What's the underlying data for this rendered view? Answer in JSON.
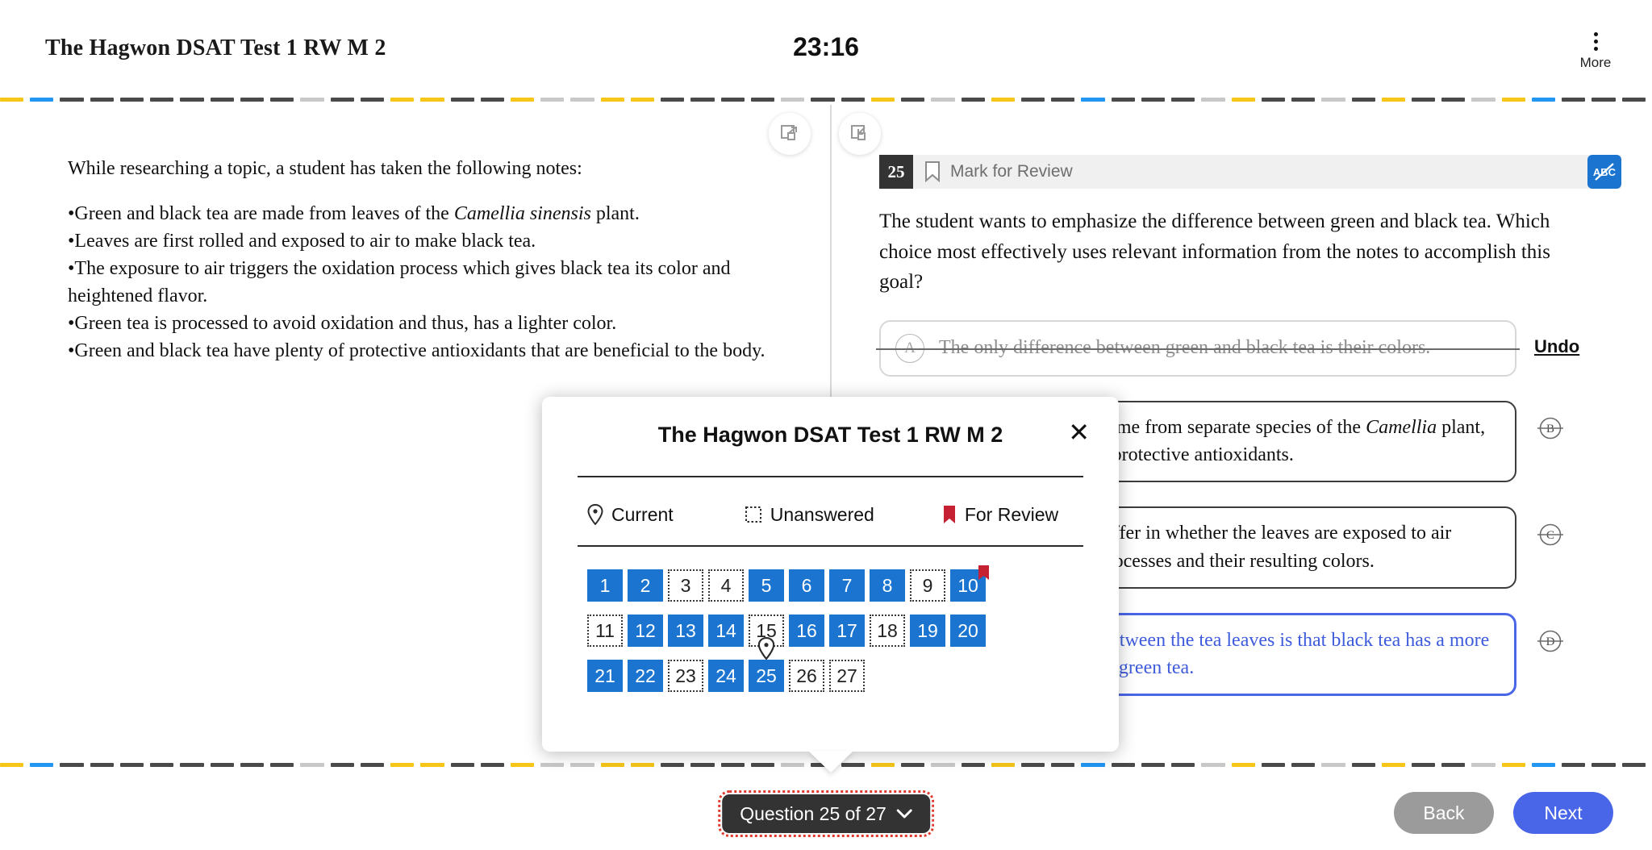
{
  "header": {
    "test_title": "The Hagwon DSAT Test 1 RW M 2",
    "timer": "23:16",
    "more_label": "More"
  },
  "divider": {
    "colors": [
      "#f5c518",
      "#2196f3",
      "#4a4a4a",
      "#4a4a4a",
      "#4a4a4a",
      "#4a4a4a",
      "#4a4a4a",
      "#4a4a4a",
      "#4a4a4a",
      "#4a4a4a",
      "#c8c8c8",
      "#4a4a4a",
      "#4a4a4a",
      "#f5c518",
      "#f5c518",
      "#4a4a4a",
      "#4a4a4a",
      "#f5c518",
      "#c8c8c8",
      "#c8c8c8",
      "#f5c518",
      "#f5c518",
      "#4a4a4a",
      "#4a4a4a",
      "#4a4a4a",
      "#4a4a4a",
      "#c8c8c8",
      "#4a4a4a",
      "#4a4a4a",
      "#f5c518",
      "#4a4a4a",
      "#c8c8c8",
      "#4a4a4a",
      "#f5c518",
      "#4a4a4a",
      "#4a4a4a",
      "#2196f3",
      "#4a4a4a",
      "#4a4a4a",
      "#4a4a4a",
      "#c8c8c8",
      "#f5c518",
      "#4a4a4a",
      "#4a4a4a",
      "#c8c8c8",
      "#4a4a4a",
      "#f5c518",
      "#4a4a4a",
      "#4a4a4a",
      "#c8c8c8"
    ]
  },
  "passage": {
    "intro": "While researching a topic, a student has taken the following notes:",
    "notes": [
      {
        "pre": "•Green and black tea are made from leaves of the ",
        "italic": "Camellia sinensis",
        "post": " plant."
      },
      {
        "pre": "•Leaves are first rolled and exposed to air to make black tea.",
        "italic": "",
        "post": ""
      },
      {
        "pre": "•The exposure to air triggers the oxidation process which gives black tea its color and heightened flavor.",
        "italic": "",
        "post": ""
      },
      {
        "pre": "•Green tea is processed to avoid oxidation and thus, has a lighter color.",
        "italic": "",
        "post": ""
      },
      {
        "pre": "•Green and black tea have plenty of protective antioxidants that are beneficial to the body.",
        "italic": "",
        "post": ""
      }
    ]
  },
  "question": {
    "number": "25",
    "mark_for_review_label": "Mark for Review",
    "abc_icon": "abc-strikethrough-icon",
    "stem": "The student wants to emphasize the difference between green and black tea. Which choice most effectively uses relevant information from the notes to accomplish this goal?",
    "undo_label": "Undo",
    "choices": [
      {
        "letter": "A",
        "pre": "The only difference between green and black tea is their colors.",
        "italic": "",
        "post": "",
        "state": "eliminated"
      },
      {
        "letter": "B",
        "pre": "Green and black tea come from separate species of the ",
        "italic": "Camellia",
        "post": " plant, and both have a lot of protective antioxidants.",
        "state": "normal"
      },
      {
        "letter": "C",
        "pre": "Green and black tea differ in whether the leaves are exposed to air during their making processes and their resulting colors.",
        "italic": "",
        "post": "",
        "state": "normal"
      },
      {
        "letter": "D",
        "pre": "The main difference between the tea leaves is that black tea has a more heightened flavor than green tea.",
        "italic": "",
        "post": "",
        "state": "selected"
      }
    ]
  },
  "modal": {
    "title": "The Hagwon DSAT Test 1 RW M 2",
    "close_icon": "close-icon",
    "legend": [
      {
        "icon": "current-pin-icon",
        "label": "Current"
      },
      {
        "icon": "unanswered-square-icon",
        "label": "Unanswered"
      },
      {
        "icon": "for-review-flag-icon",
        "label": "For Review"
      }
    ],
    "grid": [
      {
        "n": "1",
        "state": "answered",
        "flag": false,
        "current": false
      },
      {
        "n": "2",
        "state": "answered",
        "flag": false,
        "current": false
      },
      {
        "n": "3",
        "state": "unanswered",
        "flag": false,
        "current": false
      },
      {
        "n": "4",
        "state": "unanswered",
        "flag": false,
        "current": false
      },
      {
        "n": "5",
        "state": "answered",
        "flag": false,
        "current": false
      },
      {
        "n": "6",
        "state": "answered",
        "flag": false,
        "current": false
      },
      {
        "n": "7",
        "state": "answered",
        "flag": false,
        "current": false
      },
      {
        "n": "8",
        "state": "answered",
        "flag": false,
        "current": false
      },
      {
        "n": "9",
        "state": "unanswered",
        "flag": false,
        "current": false
      },
      {
        "n": "10",
        "state": "answered",
        "flag": true,
        "current": false
      },
      {
        "n": "11",
        "state": "unanswered",
        "flag": false,
        "current": false
      },
      {
        "n": "12",
        "state": "answered",
        "flag": false,
        "current": false
      },
      {
        "n": "13",
        "state": "answered",
        "flag": false,
        "current": false
      },
      {
        "n": "14",
        "state": "answered",
        "flag": false,
        "current": false
      },
      {
        "n": "15",
        "state": "unanswered",
        "flag": false,
        "current": false
      },
      {
        "n": "16",
        "state": "answered",
        "flag": false,
        "current": false
      },
      {
        "n": "17",
        "state": "answered",
        "flag": false,
        "current": false
      },
      {
        "n": "18",
        "state": "unanswered",
        "flag": false,
        "current": false
      },
      {
        "n": "19",
        "state": "answered",
        "flag": false,
        "current": false
      },
      {
        "n": "20",
        "state": "answered",
        "flag": false,
        "current": false
      },
      {
        "n": "21",
        "state": "answered",
        "flag": false,
        "current": false
      },
      {
        "n": "22",
        "state": "answered",
        "flag": false,
        "current": false
      },
      {
        "n": "23",
        "state": "unanswered",
        "flag": false,
        "current": false
      },
      {
        "n": "24",
        "state": "answered",
        "flag": false,
        "current": false
      },
      {
        "n": "25",
        "state": "answered",
        "flag": false,
        "current": true
      },
      {
        "n": "26",
        "state": "unanswered",
        "flag": false,
        "current": false
      },
      {
        "n": "27",
        "state": "unanswered",
        "flag": false,
        "current": false
      }
    ]
  },
  "footer": {
    "question_picker": "Question 25 of 27",
    "back_label": "Back",
    "next_label": "Next"
  },
  "colors": {
    "answered_blue": "#1b75d0",
    "selected_blue": "#4a66e8",
    "review_red": "#c62033",
    "accent_yellow": "#f5c518",
    "dark": "#333333"
  }
}
